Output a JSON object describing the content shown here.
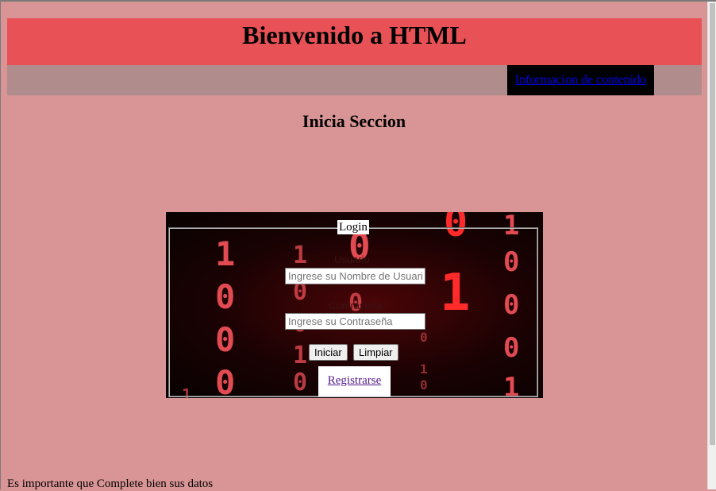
{
  "header": {
    "title": "Bienvenido a HTML"
  },
  "nav": {
    "link_label": "Informacion de contenido"
  },
  "section": {
    "title": "Inicia Seccion"
  },
  "login": {
    "legend": "Login",
    "username": {
      "label": "Usuario",
      "placeholder": "Ingrese su Nombre de Usuario",
      "value": ""
    },
    "password": {
      "label": "Contraseña",
      "placeholder": "Ingrese su Contraseña",
      "value": ""
    },
    "submit_label": "Iniciar",
    "reset_label": "Limpiar",
    "register_label": "Registrarse"
  },
  "footer": {
    "note": "Es importante que Complete bien sus datos"
  },
  "colors": {
    "page_background": "#d99595",
    "header_background": "#e85156",
    "nav_background": "#b08c8c",
    "nav_link_box": "#000000",
    "digit_color": "#e34b52"
  },
  "icons": {
    "background_pattern": "binary-digits-background"
  }
}
